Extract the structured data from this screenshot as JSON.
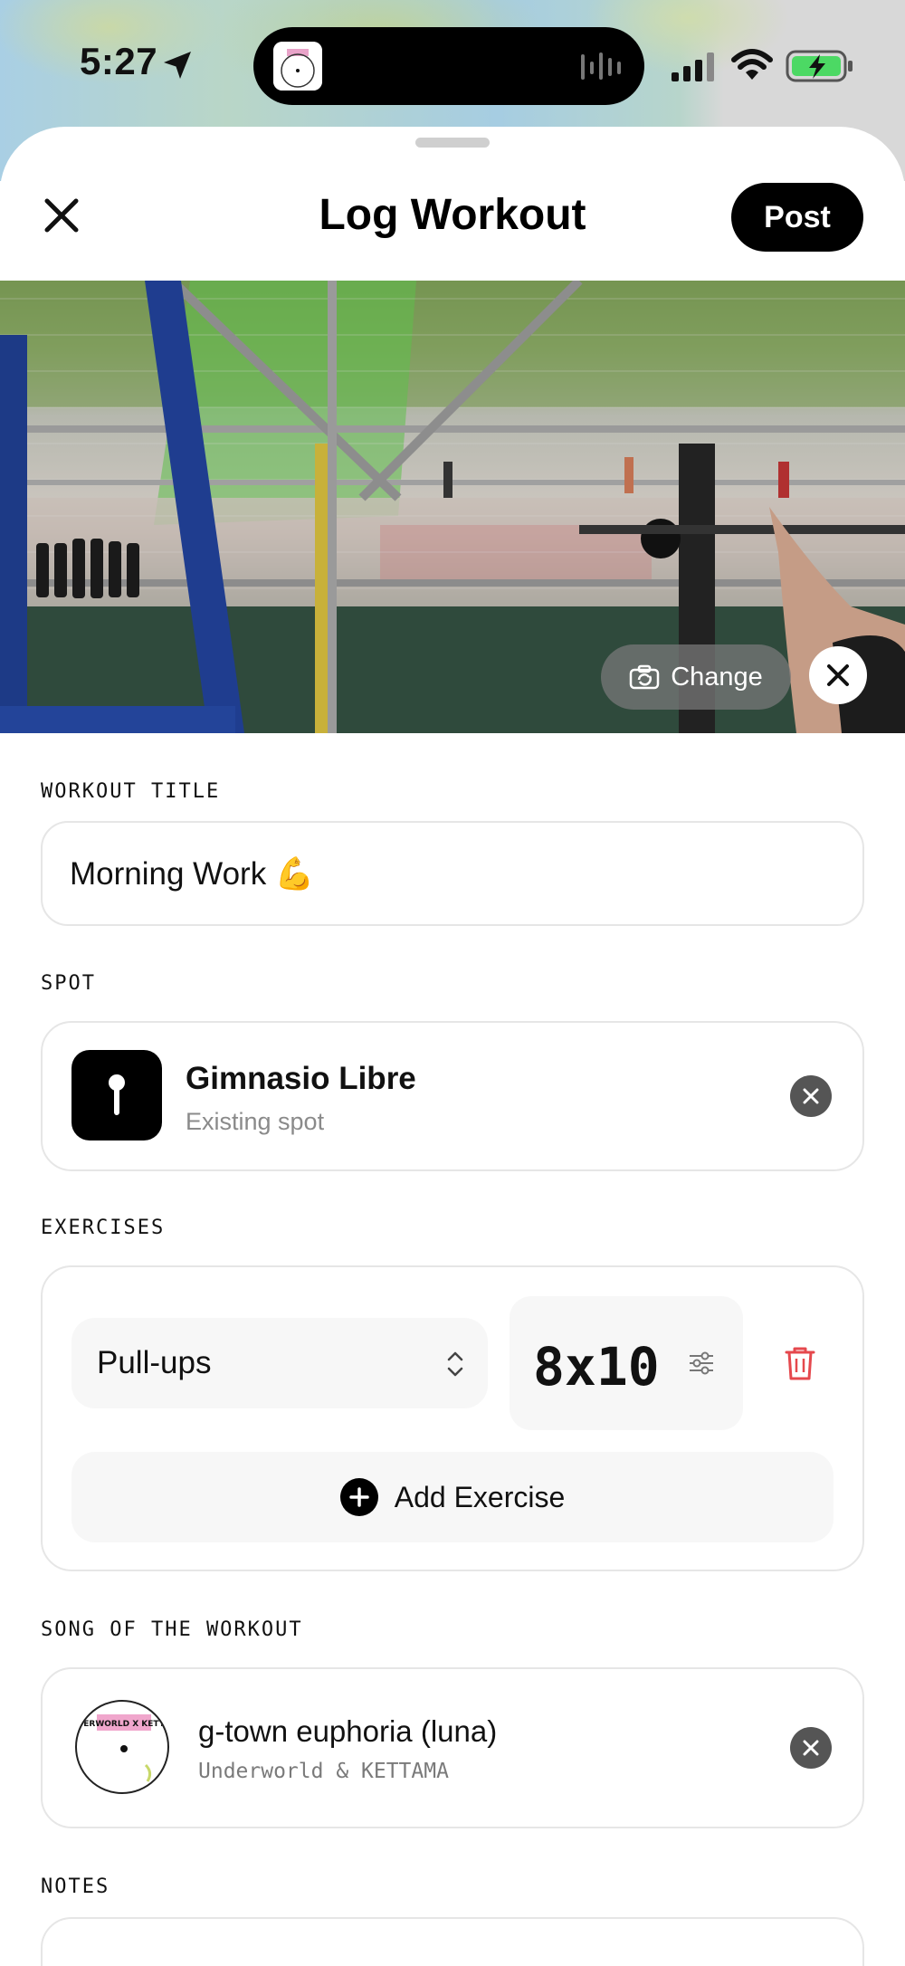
{
  "status_bar": {
    "time": "5:27"
  },
  "header": {
    "title": "Log Workout",
    "post_label": "Post"
  },
  "photo": {
    "change_label": "Change"
  },
  "workout_title": {
    "label": "WORKOUT TITLE",
    "value": "Morning Work 💪"
  },
  "spot": {
    "label": "SPOT",
    "name": "Gimnasio Libre",
    "subtitle": "Existing spot"
  },
  "exercises": {
    "label": "EXERCISES",
    "items": [
      {
        "name": "Pull-ups",
        "sets": "8x10"
      }
    ],
    "add_label": "Add Exercise"
  },
  "song": {
    "label": "SONG OF THE WORKOUT",
    "title": "g-town euphoria (luna)",
    "artist": "Underworld & KETTAMA",
    "art_text": "UNDERWORLD X KETTAMA"
  },
  "notes": {
    "label": "NOTES"
  },
  "colors": {
    "accent": "#000000",
    "danger": "#e5484d",
    "border": "#e6e6e6",
    "muted": "#8a8a8a"
  }
}
